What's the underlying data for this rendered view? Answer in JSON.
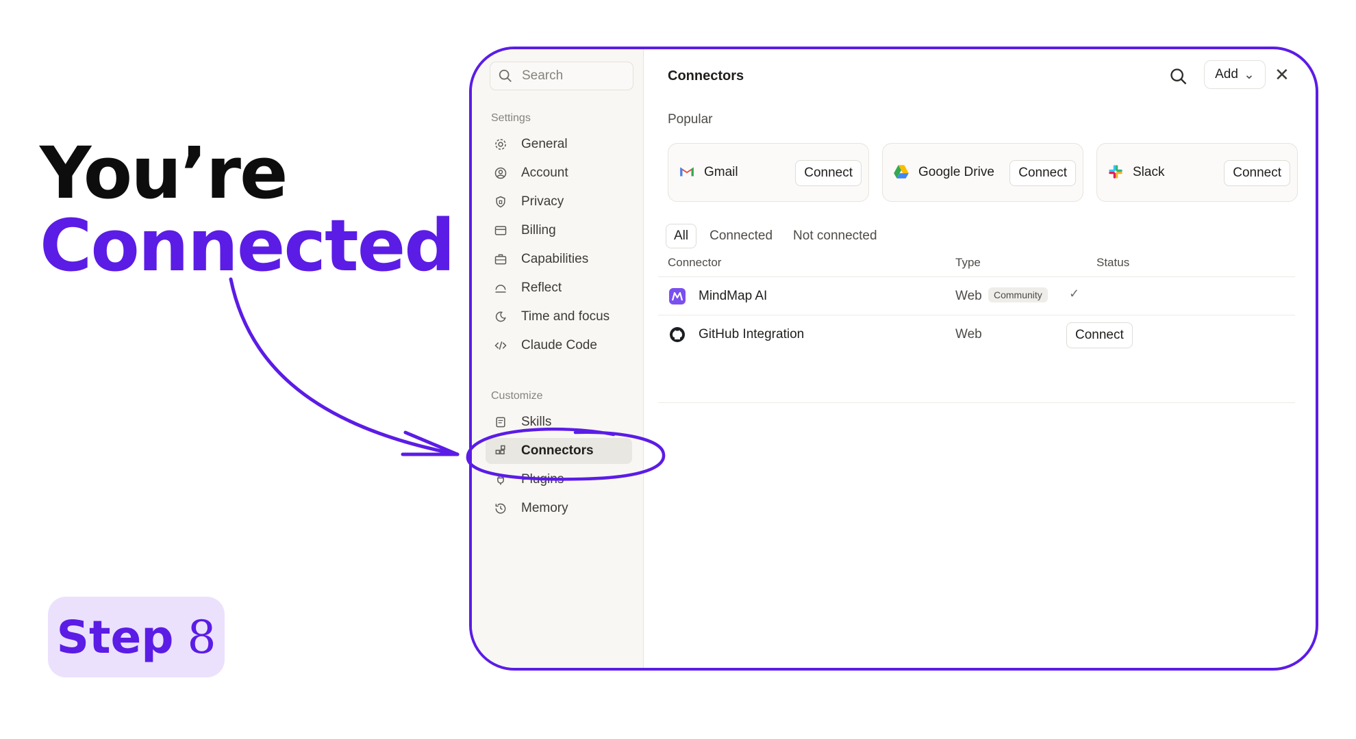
{
  "headline": {
    "line1": "You’re",
    "line2": "Connected"
  },
  "step": {
    "word": "Step",
    "number": "8"
  },
  "colors": {
    "accent": "#5b1ce6",
    "step_bg": "#ebe1fd"
  },
  "sidebar": {
    "search_placeholder": "Search",
    "settings_label": "Settings",
    "settings_items": [
      {
        "label": "General",
        "icon": "gear-icon"
      },
      {
        "label": "Account",
        "icon": "user-circle-icon"
      },
      {
        "label": "Privacy",
        "icon": "shield-icon"
      },
      {
        "label": "Billing",
        "icon": "credit-card-icon"
      },
      {
        "label": "Capabilities",
        "icon": "briefcase-icon"
      },
      {
        "label": "Reflect",
        "icon": "reflect-icon"
      },
      {
        "label": "Time and focus",
        "icon": "moon-icon"
      },
      {
        "label": "Claude Code",
        "icon": "code-icon"
      }
    ],
    "customize_label": "Customize",
    "customize_items": [
      {
        "label": "Skills",
        "icon": "scroll-icon"
      },
      {
        "label": "Connectors",
        "icon": "grid-icon",
        "active": true
      },
      {
        "label": "Plugins",
        "icon": "plug-icon"
      },
      {
        "label": "Memory",
        "icon": "history-icon"
      }
    ]
  },
  "main": {
    "title": "Connectors",
    "add_label": "Add",
    "popular_label": "Popular",
    "popular": [
      {
        "name": "Gmail",
        "button": "Connect"
      },
      {
        "name": "Google Drive",
        "button": "Connect"
      },
      {
        "name": "Slack",
        "button": "Connect"
      }
    ],
    "tabs": [
      "All",
      "Connected",
      "Not connected"
    ],
    "columns": [
      "Connector",
      "Type",
      "Status"
    ],
    "rows": [
      {
        "name": "MindMap AI",
        "type": "Web",
        "badge": "Community",
        "status": "✓"
      },
      {
        "name": "GitHub Integration",
        "type": "Web",
        "status_button": "Connect"
      }
    ]
  }
}
